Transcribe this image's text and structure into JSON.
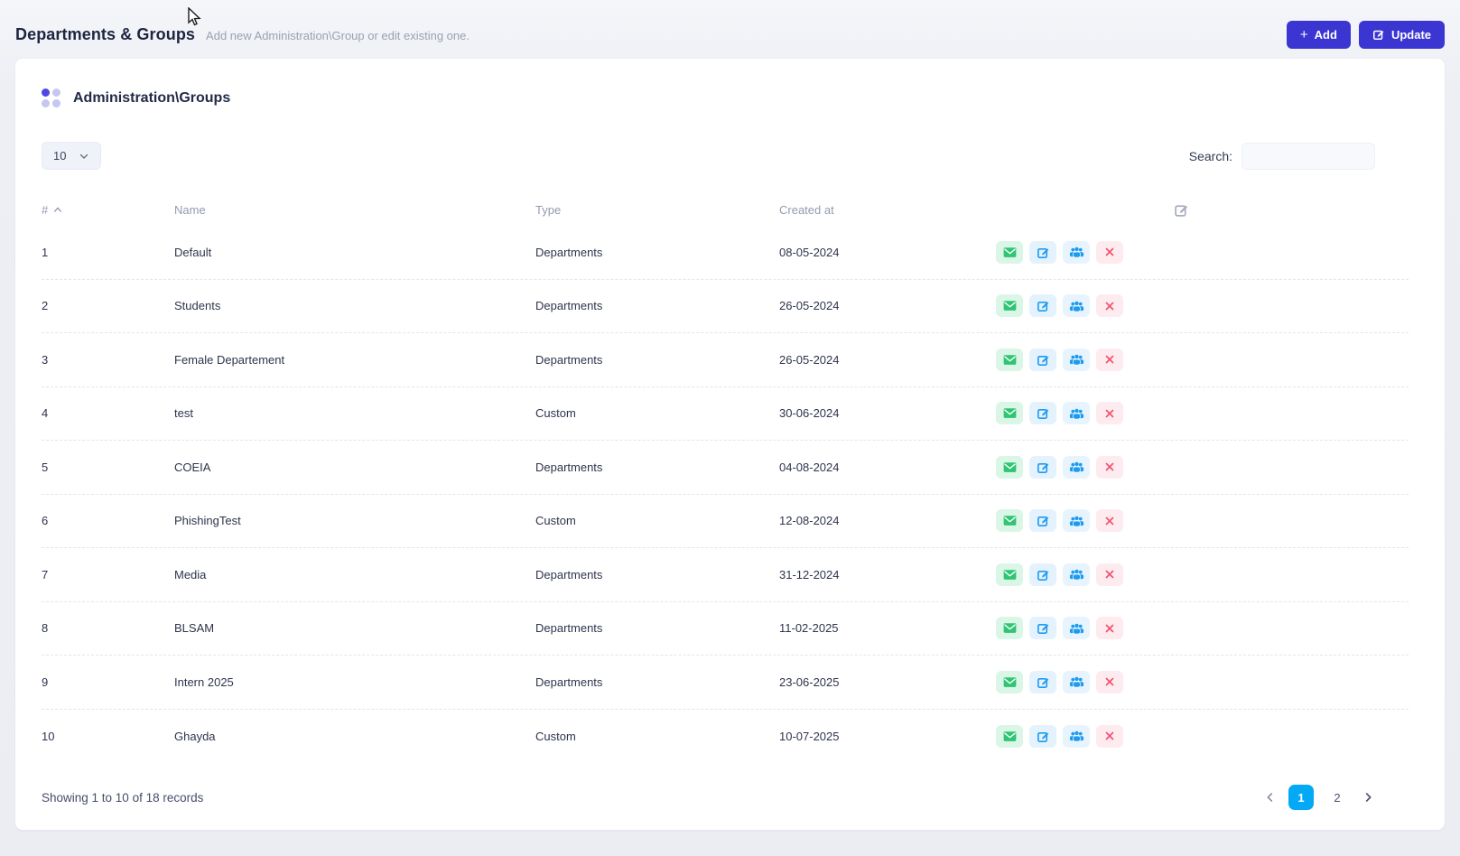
{
  "header": {
    "title": "Departments & Groups",
    "subtitle": "Add new Administration\\Group or edit existing one.",
    "add_label": "Add",
    "update_label": "Update"
  },
  "card": {
    "title": "Administration\\Groups",
    "page_size": "10",
    "search_label": "Search:",
    "search_value": ""
  },
  "table": {
    "columns": [
      "#",
      "Name",
      "Type",
      "Created at"
    ],
    "sorted_column": "#",
    "sort_direction": "asc",
    "row_actions": [
      "send-mail",
      "edit",
      "members",
      "delete"
    ],
    "rows": [
      {
        "id": "1",
        "name": "Default",
        "type": "Departments",
        "created_at": "08-05-2024"
      },
      {
        "id": "2",
        "name": "Students",
        "type": "Departments",
        "created_at": "26-05-2024"
      },
      {
        "id": "3",
        "name": "Female Departement",
        "type": "Departments",
        "created_at": "26-05-2024"
      },
      {
        "id": "4",
        "name": "test",
        "type": "Custom",
        "created_at": "30-06-2024"
      },
      {
        "id": "5",
        "name": "COEIA",
        "type": "Departments",
        "created_at": "04-08-2024"
      },
      {
        "id": "6",
        "name": "PhishingTest",
        "type": "Custom",
        "created_at": "12-08-2024"
      },
      {
        "id": "7",
        "name": "Media",
        "type": "Departments",
        "created_at": "31-12-2024"
      },
      {
        "id": "8",
        "name": "BLSAM",
        "type": "Departments",
        "created_at": "11-02-2025"
      },
      {
        "id": "9",
        "name": "Intern 2025",
        "type": "Departments",
        "created_at": "23-06-2025"
      },
      {
        "id": "10",
        "name": "Ghayda",
        "type": "Custom",
        "created_at": "10-07-2025"
      }
    ]
  },
  "footer": {
    "showing_text": "Showing 1 to 10 of 18 records",
    "pages": [
      "1",
      "2"
    ],
    "active_page": "1"
  },
  "colors": {
    "accent_indigo": "#3b36d1",
    "active_page_blue": "#03a9f4",
    "mail_green": "#2fc573",
    "mail_bg": "#daf6e6",
    "action_blue": "#1d9bf0",
    "action_blue_bg": "#e4f2fd",
    "delete_red": "#f25270",
    "delete_bg": "#fdebef",
    "dot_indigo": "#4f46e5",
    "dot_lavender": "#c6c7f1"
  }
}
